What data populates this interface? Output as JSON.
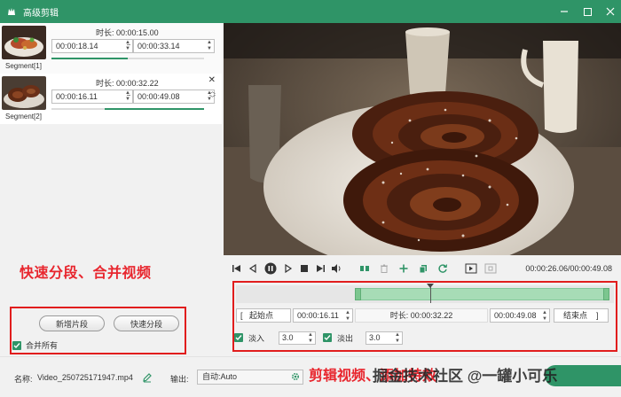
{
  "window": {
    "title": "高级剪辑"
  },
  "segments": [
    {
      "label": "Segment[1]",
      "duration_label": "时长:",
      "duration": "00:00:15.00",
      "start": "00:00:18.14",
      "end": "00:00:33.14",
      "fill_fraction": 0.5
    },
    {
      "label": "Segment[2]",
      "duration_label": "时长:",
      "duration": "00:00:32.22",
      "start": "00:00:16.11",
      "end": "00:00:49.08",
      "fill_fraction": 0.65
    }
  ],
  "left_panel": {
    "annotation": "快速分段、合并视频",
    "add_segment_label": "新增片段",
    "quick_split_label": "快速分段",
    "merge_all_label": "合并所有",
    "merge_all_checked": true
  },
  "player": {
    "current_time": "00:00:26.06",
    "total_time": "00:00:49.08",
    "time_display": "00:00:26.06/00:00:49.08"
  },
  "clip": {
    "start_label": "起始点",
    "start_value": "00:00:16.11",
    "duration_label": "时长:",
    "duration_value": "00:00:32.22",
    "end_value": "00:00:49.08",
    "end_label": "结束点",
    "fade_in_label": "淡入",
    "fade_in_value": "3.0",
    "fade_in_checked": true,
    "fade_out_label": "淡出",
    "fade_out_value": "3.0",
    "fade_out_checked": true,
    "annotation": "剪辑视频、添加特效"
  },
  "watermark": {
    "text": "掘金技术社区 @一罐小可乐",
    "logo_text": ""
  },
  "bottom_bar": {
    "name_label": "名称:",
    "name_value": "Video_250725171947.mp4",
    "output_label": "输出:",
    "output_value": "自动:Auto"
  },
  "colors": {
    "accent": "#2f9467",
    "annotation_red": "#e8262e",
    "selection": "#a7dcb6"
  }
}
